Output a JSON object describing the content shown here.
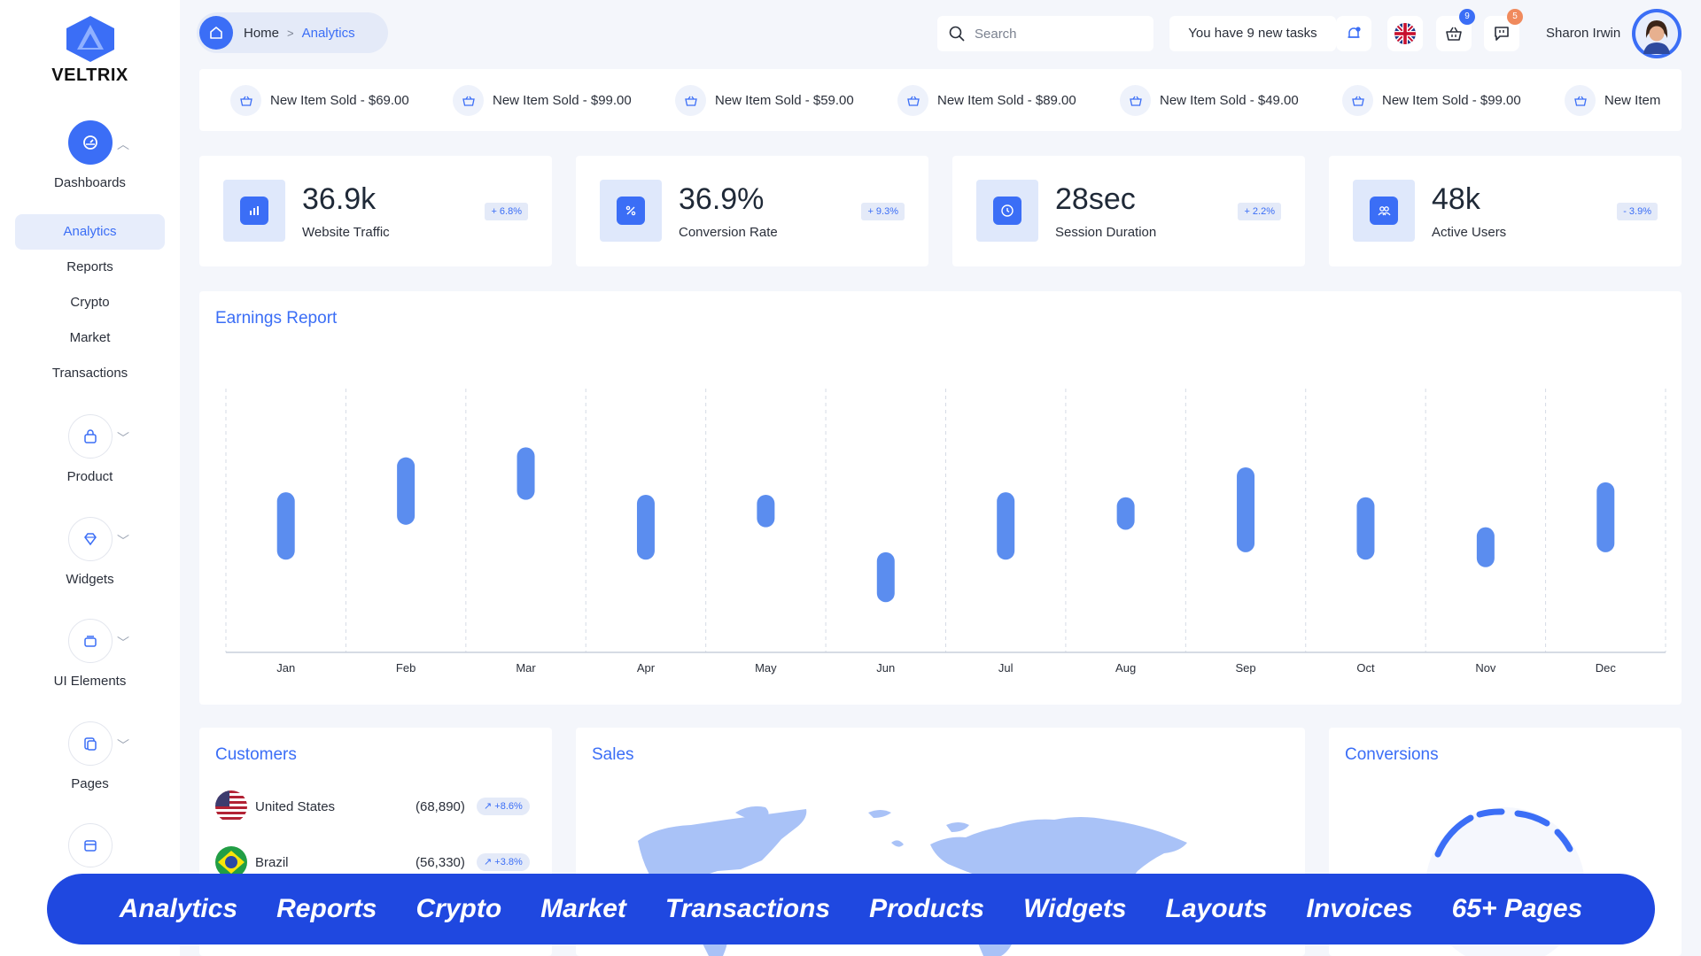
{
  "brand": {
    "name": "VELTRIX",
    "accent": "#3b6ef6"
  },
  "sidebar": {
    "dashboards_label": "Dashboards",
    "subitems": [
      "Analytics",
      "Reports",
      "Crypto",
      "Market",
      "Transactions"
    ],
    "groups": [
      {
        "label": "Product",
        "icon": "bag-icon"
      },
      {
        "label": "Widgets",
        "icon": "diamond-icon"
      },
      {
        "label": "UI Elements",
        "icon": "box-icon"
      },
      {
        "label": "Pages",
        "icon": "pages-icon"
      },
      {
        "label": "",
        "icon": "calendar-icon"
      }
    ]
  },
  "header": {
    "breadcrumb": {
      "home": "Home",
      "current": "Analytics"
    },
    "search_placeholder": "Search",
    "tasks_text": "You have 9 new tasks",
    "cart_badge": "9",
    "chat_badge": "5",
    "user_name": "Sharon Irwin"
  },
  "ticker": [
    {
      "text": "New Item Sold -  $69.00"
    },
    {
      "text": "New Item Sold -  $99.00"
    },
    {
      "text": "New Item Sold -  $59.00"
    },
    {
      "text": "New Item Sold -  $89.00"
    },
    {
      "text": "New Item Sold -  $49.00"
    },
    {
      "text": "New Item Sold -  $99.00"
    },
    {
      "text": "New Item"
    }
  ],
  "stats": [
    {
      "value": "36.9k",
      "label": "Website Traffic",
      "change": "+ 6.8%",
      "icon": "bar-chart-icon"
    },
    {
      "value": "36.9%",
      "label": "Conversion Rate",
      "change": "+ 9.3%",
      "icon": "percent-icon"
    },
    {
      "value": "28sec",
      "label": "Session Duration",
      "change": "+ 2.2%",
      "icon": "clock-icon"
    },
    {
      "value": "48k",
      "label": "Active Users",
      "change": "- 3.9%",
      "icon": "users-icon"
    }
  ],
  "earnings": {
    "title": "Earnings Report"
  },
  "chart_data": {
    "type": "bar",
    "title": "Earnings Report",
    "categories": [
      "Jan",
      "Feb",
      "Mar",
      "Apr",
      "May",
      "Jun",
      "Jul",
      "Aug",
      "Sep",
      "Oct",
      "Nov",
      "Dec"
    ],
    "ranges": [
      [
        0.35,
        0.62
      ],
      [
        0.49,
        0.76
      ],
      [
        0.59,
        0.8
      ],
      [
        0.35,
        0.61
      ],
      [
        0.48,
        0.61
      ],
      [
        0.18,
        0.38
      ],
      [
        0.35,
        0.62
      ],
      [
        0.47,
        0.6
      ],
      [
        0.38,
        0.72
      ],
      [
        0.35,
        0.6
      ],
      [
        0.32,
        0.48
      ],
      [
        0.38,
        0.66
      ]
    ],
    "grid": "vertical-dashed",
    "legend": "none",
    "color": "#5b8def"
  },
  "customers": {
    "title": "Customers",
    "rows": [
      {
        "country": "United States",
        "count": "(68,890)",
        "change": "↗ +8.6%"
      },
      {
        "country": "Brazil",
        "count": "(56,330)",
        "change": "↗ +3.8%"
      }
    ]
  },
  "sales": {
    "title": "Sales"
  },
  "conversions": {
    "title": "Conversions"
  },
  "banner": [
    "Analytics",
    "Reports",
    "Crypto",
    "Market",
    "Transactions",
    "Products",
    "Widgets",
    "Layouts",
    "Invoices",
    "65+ Pages"
  ]
}
